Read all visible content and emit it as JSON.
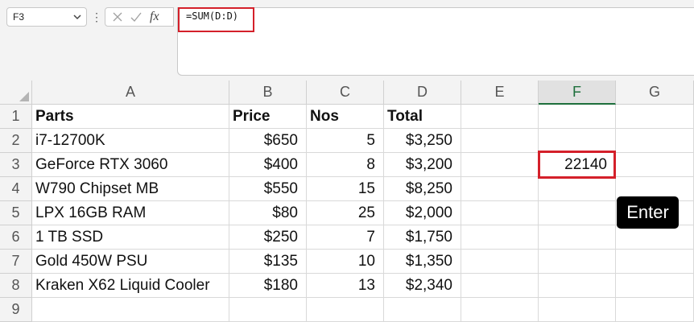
{
  "name_box": {
    "value": "F3"
  },
  "formula_bar": {
    "fx_label": "fx",
    "formula": "=SUM(D:D)"
  },
  "columns": [
    "A",
    "B",
    "C",
    "D",
    "E",
    "F",
    "G"
  ],
  "selected_column": "F",
  "rows": [
    {
      "num": "1",
      "A": "Parts",
      "B": "Price",
      "C": "Nos",
      "D": "Total",
      "E": "",
      "F": "",
      "G": ""
    },
    {
      "num": "2",
      "A": "i7-12700K",
      "B": "$650",
      "C": "5",
      "D": "$3,250",
      "E": "",
      "F": "",
      "G": ""
    },
    {
      "num": "3",
      "A": "GeForce RTX 3060",
      "B": "$400",
      "C": "8",
      "D": "$3,200",
      "E": "",
      "F": "22140",
      "G": ""
    },
    {
      "num": "4",
      "A": "W790 Chipset MB",
      "B": "$550",
      "C": "15",
      "D": "$8,250",
      "E": "",
      "F": "",
      "G": ""
    },
    {
      "num": "5",
      "A": "LPX 16GB RAM",
      "B": "$80",
      "C": "25",
      "D": "$2,000",
      "E": "",
      "F": "",
      "G": ""
    },
    {
      "num": "6",
      "A": "1 TB SSD",
      "B": "$250",
      "C": "7",
      "D": "$1,750",
      "E": "",
      "F": "",
      "G": ""
    },
    {
      "num": "7",
      "A": "Gold 450W PSU",
      "B": "$135",
      "C": "10",
      "D": "$1,350",
      "E": "",
      "F": "",
      "G": ""
    },
    {
      "num": "8",
      "A": "Kraken X62 Liquid Cooler",
      "B": "$180",
      "C": "13",
      "D": "$2,340",
      "E": "",
      "F": "",
      "G": ""
    },
    {
      "num": "9",
      "A": "",
      "B": "",
      "C": "",
      "D": "",
      "E": "",
      "F": "",
      "G": ""
    }
  ],
  "enter_badge": "Enter",
  "colors": {
    "highlight": "#d4202a",
    "selected_header": "#1e6f3c"
  },
  "icons": [
    "chevron-down-icon",
    "more-options-icon",
    "cancel-icon",
    "confirm-icon",
    "insert-function-icon"
  ]
}
